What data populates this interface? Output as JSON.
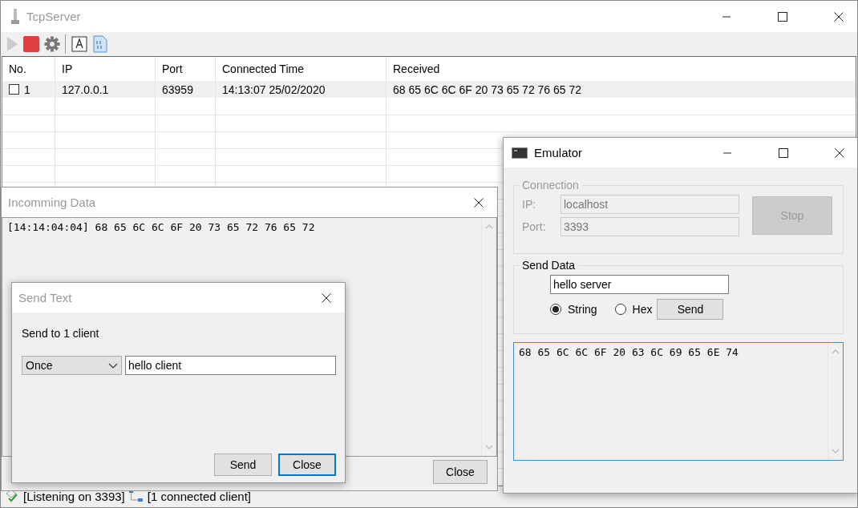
{
  "main_window": {
    "title": "TcpServer",
    "toolbar": [
      {
        "kind": "play",
        "disabled": true
      },
      {
        "kind": "stop",
        "disabled": false
      },
      {
        "kind": "settings",
        "disabled": false
      },
      {
        "kind": "text",
        "disabled": false
      },
      {
        "kind": "binary",
        "disabled": false
      }
    ],
    "table": {
      "columns": [
        "No.",
        "IP",
        "Port",
        "Connected Time",
        "Received"
      ],
      "rows": [
        {
          "checked": false,
          "cells": [
            "1",
            "127.0.0.1",
            "63959",
            "14:13:07 25/02/2020",
            "68 65 6C 6C 6F 20 73 65 72 76 65 72"
          ]
        }
      ]
    },
    "status_bar": [
      "[Listening on 3393]",
      "[1 connected client]"
    ]
  },
  "incoming_window": {
    "title": "Incomming Data",
    "lines": [
      "[14:14:04:04] 68 65 6C 6C 6F 20 73 65 72 76 65 72"
    ],
    "close_button": "Close"
  },
  "send_text_dialog": {
    "title": "Send Text",
    "label": "Send to 1 client",
    "mode": "Once",
    "text": "hello client",
    "buttons": [
      {
        "label": "Send",
        "default": false
      },
      {
        "label": "Close",
        "default": true
      }
    ]
  },
  "emulator_window": {
    "title": "Emulator",
    "connection": {
      "legend": "Connection",
      "disabled": true,
      "ip_label": "IP:",
      "ip": "localhost",
      "port_label": "Port:",
      "port": "3393",
      "button": "Stop"
    },
    "send_data": {
      "legend": "Send Data",
      "text": "hello server",
      "options": [
        {
          "label": "String",
          "selected": true
        },
        {
          "label": "Hex",
          "selected": false
        }
      ],
      "button": "Send"
    },
    "output": "68 65 6C 6C 6F 20 63 6C 69 65 6E 74"
  }
}
